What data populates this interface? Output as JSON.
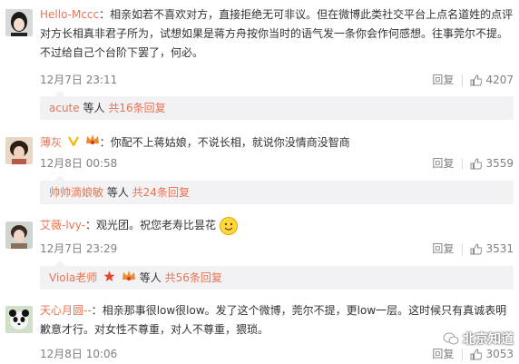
{
  "comments": [
    {
      "username": "Hello-Mccc",
      "separator": "：",
      "text_line1": "相亲如若不喜欢对方，直接拒绝无可非议。但在微博此类社交平台上点名道姓的点评",
      "text_line2": "对方长相真非君子所为，试想如果是蒋方舟按你当时的语气发一条你会作何感想。往事莞尔不提。",
      "text_line3": "不过给自己个台阶下罢了，何必。",
      "time": "12月7日 23:11",
      "reply_label": "回复",
      "likes": "4207",
      "reply_summary": {
        "name": "acute",
        "suffix": " 等人",
        "link": "共16条回复"
      }
    },
    {
      "username": "薄灰",
      "separator": "：",
      "text_line1": "你配不上蒋姑娘，不说长相，就说你没情商没智商",
      "time": "12月8日 00:58",
      "reply_label": "回复",
      "likes": "3559",
      "reply_summary": {
        "name": "帅帅滴娘敏",
        "suffix": " 等人",
        "link": "共24条回复"
      }
    },
    {
      "username": "艾薇-lvy-",
      "separator": "：",
      "text_line1": "观光团。祝您老寿比昙花",
      "time": "12月7日 23:29",
      "reply_label": "回复",
      "likes": "3531",
      "reply_summary": {
        "name": "Viola老师",
        "suffix": " 等人",
        "link": "共56条回复"
      }
    },
    {
      "username": "天心月圆--",
      "separator": "：",
      "text_line1": "相亲那事很low很low。发了这个微博，莞尔不提，更low一层。这时候只有真诚表明",
      "text_line2": "歉意才行。对女性不尊重，对人不尊重，猥琐。",
      "time": "12月8日 10:06",
      "reply_label": "回复",
      "likes": "3053"
    }
  ],
  "watermark": "北京知道",
  "colors": {
    "username": "#eb7350",
    "meta": "#808080",
    "reply_bg": "#f2f2f5",
    "divider": "#d9d9d9"
  }
}
